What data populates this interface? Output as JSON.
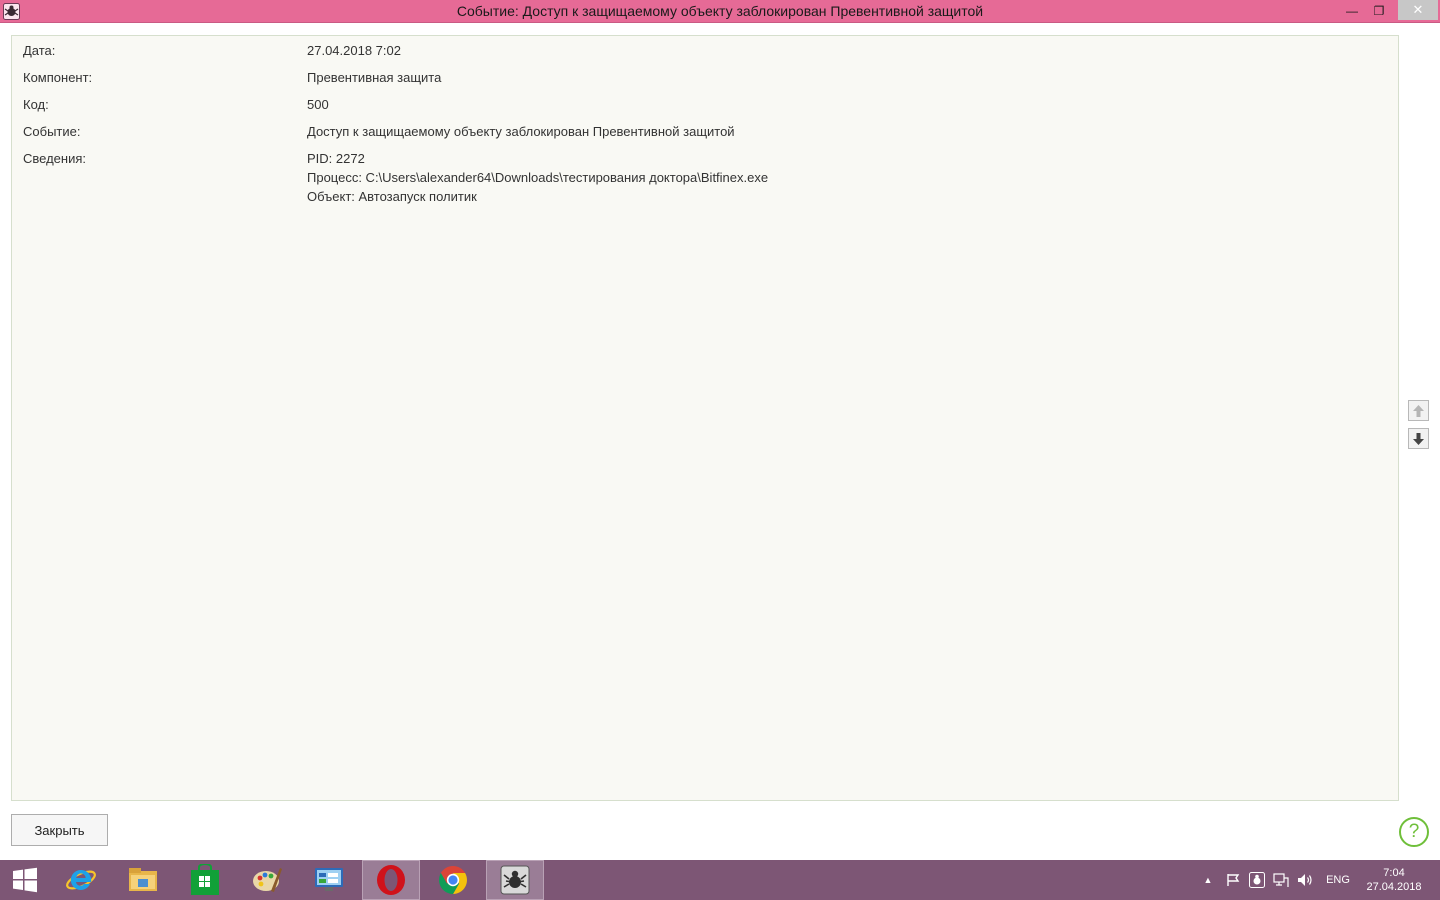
{
  "window": {
    "title": "Событие: Доступ к защищаемому объекту заблокирован Превентивной защитой",
    "minimize_glyph": "—",
    "maximize_glyph": "❐",
    "close_glyph": "✕"
  },
  "details": {
    "date_label": "Дата:",
    "date_value": "27.04.2018 7:02",
    "component_label": "Компонент:",
    "component_value": "Превентивная защита",
    "code_label": "Код:",
    "code_value": "500",
    "event_label": "Событие:",
    "event_value": "Доступ к защищаемому объекту заблокирован Превентивной защитой",
    "info_label": "Сведения:",
    "info_lines": [
      "PID: 2272",
      "Процесс: C:\\Users\\alexander64\\Downloads\\тестирования доктора\\Bitfinex.exe",
      "Объект: Автозапуск политик"
    ]
  },
  "nav": {
    "up_icon": "arrow-up-icon",
    "down_icon": "arrow-down-icon"
  },
  "footer": {
    "close_label": "Закрыть",
    "help_glyph": "?"
  },
  "taskbar": {
    "apps": [
      "windows-logo-icon",
      "internet-explorer-icon",
      "file-explorer-icon",
      "store-icon",
      "paint-icon",
      "control-panel-icon",
      "opera-icon",
      "chrome-icon",
      "drweb-icon"
    ],
    "tray": {
      "show_hidden_glyph": "▲",
      "language": "ENG",
      "time": "7:04",
      "date": "27.04.2018"
    }
  },
  "colors": {
    "titlebar": "#e66a96",
    "panel_bg": "#f9f9f4",
    "taskbar": "#7d5675",
    "help_green": "#6fbf3a"
  }
}
